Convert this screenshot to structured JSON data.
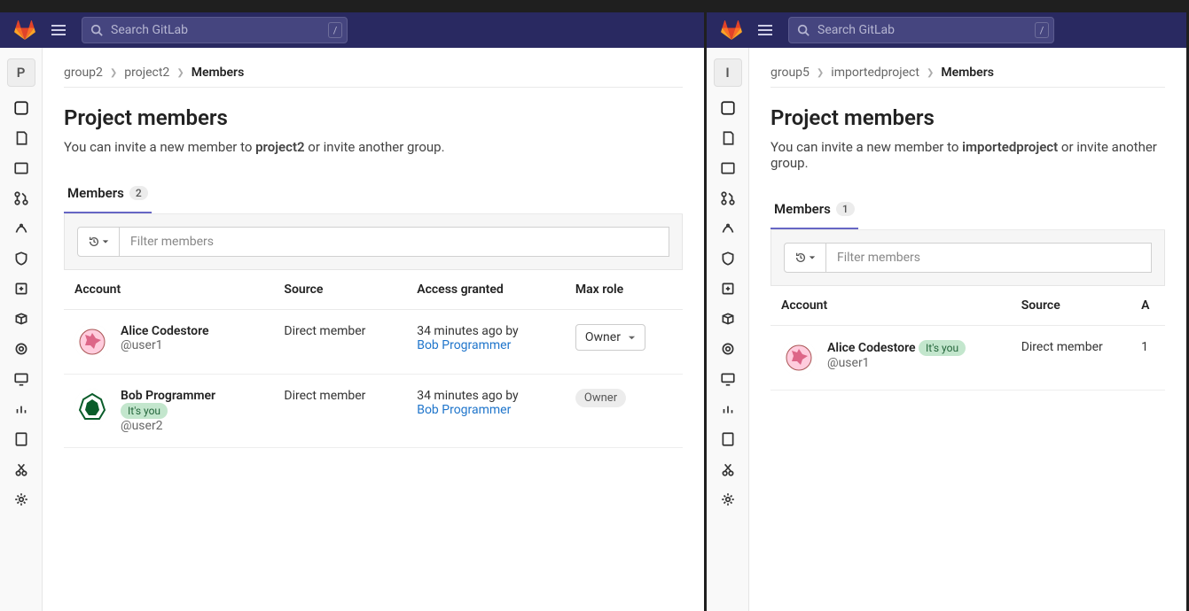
{
  "search": {
    "placeholder": "Search GitLab",
    "shortcut": "/"
  },
  "left": {
    "projectInitial": "P",
    "breadcrumb": [
      "group2",
      "project2",
      "Members"
    ],
    "title": "Project members",
    "subtext_pre": "You can invite a new member to ",
    "subtext_bold": "project2",
    "subtext_post": " or invite another group.",
    "tab_label": "Members",
    "tab_count": "2",
    "filter_placeholder": "Filter members",
    "cols": {
      "account": "Account",
      "source": "Source",
      "access": "Access granted",
      "role": "Max role"
    },
    "its_you": "It's you",
    "members": [
      {
        "name": "Alice Codestore",
        "handle": "@user1",
        "its_you": false,
        "source": "Direct member",
        "when": "34 minutes ago by",
        "by": "Bob Programmer",
        "role": "Owner",
        "role_editable": true,
        "avatar": "alice"
      },
      {
        "name": "Bob Programmer",
        "handle": "@user2",
        "its_you": true,
        "source": "Direct member",
        "when": "34 minutes ago by",
        "by": "Bob Programmer",
        "role": "Owner",
        "role_editable": false,
        "avatar": "bob"
      }
    ]
  },
  "right": {
    "projectInitial": "I",
    "breadcrumb": [
      "group5",
      "importedproject",
      "Members"
    ],
    "title": "Project members",
    "subtext_pre": "You can invite a new member to ",
    "subtext_bold": "importedproject",
    "subtext_post": " or invite another group.",
    "tab_label": "Members",
    "tab_count": "1",
    "filter_placeholder": "Filter members",
    "cols": {
      "account": "Account",
      "source": "Source",
      "access": "A"
    },
    "its_you": "It's you",
    "members": [
      {
        "name": "Alice Codestore",
        "handle": "@user1",
        "its_you": true,
        "source": "Direct member",
        "access_partial": "1",
        "avatar": "alice"
      }
    ]
  }
}
